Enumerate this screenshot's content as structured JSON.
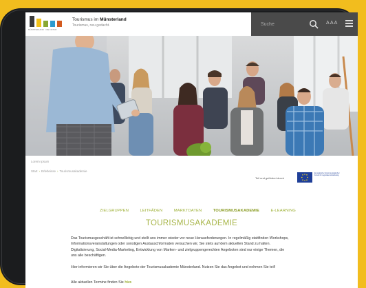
{
  "header": {
    "brand_prefix": "Tourismus im",
    "brand_region": "Münsterland",
    "tagline": "Tourismus, neu gedacht.",
    "org_label": "MÜNSTERLAND · DIE NATUR",
    "search_placeholder": "Suche",
    "font_size_label": "A A A",
    "logo_colors": [
      "#3b3b3b",
      "#f2c21a",
      "#8aa832",
      "#2e9bcf",
      "#d35a1f"
    ]
  },
  "hero": {
    "caption": "Lorem Ipsum"
  },
  "breadcrumb": [
    "Start",
    "Erlebnisse",
    "Tourismusakademie"
  ],
  "funding": {
    "note": "Teil und gefördert durch",
    "eu_label": "Europäische Union Europäischer Fonds für regionale Entwicklung"
  },
  "nav": {
    "items": [
      "ZIELGRUPPEN",
      "LEITFÄDEN",
      "MARKTDATEN",
      "TOURISMUSAKADEMIE",
      "E-LEARNING"
    ],
    "active": "TOURISMUSAKADEMIE"
  },
  "page": {
    "title": "TOURISMUSAKADEMIE",
    "paragraph1": "Das Tourismusgeschäft ist schnelllebig und stellt uns immer wieder vor neue Herausforderungen. In regelmäßig stattfinden Workshops, Informationsveranstaltungen oder sonstigen Austauschformaten versuchen wir, Sie stets auf dem aktuellen Stand zu halten. Digitalisierung, Social-Media-Marketing, Entwicklung von Marken- und zielgruppengerechten Angeboten sind nur einige Themen, die uns alle beschäftigen.",
    "paragraph2": "Hier informieren wir Sie über die Angebote der Tourismusakademie Münsterland. Nutzen Sie das Angebot und nehmen Sie teil!",
    "paragraph3_prefix": "Alle aktuellen Termine finden Sie",
    "paragraph3_link": "hier."
  },
  "colors": {
    "accent_green": "#9fb23a",
    "title_green": "#a8b64a",
    "header_dark": "#4a4a4a",
    "background_yellow": "#f2bd1e"
  }
}
